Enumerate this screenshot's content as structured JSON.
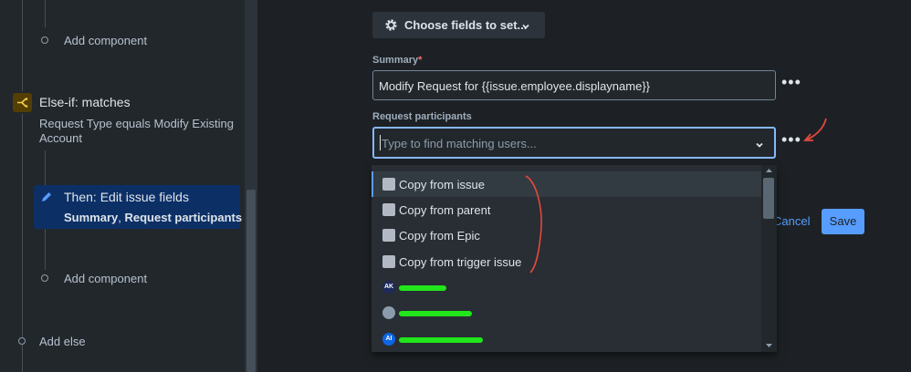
{
  "rule_panel": {
    "add_component_top": "Add component",
    "else_if_title": "Else-if: matches",
    "else_if_condition_line1": "Request Type equals Modify Existing",
    "else_if_condition_line2": "Account",
    "then_title": "Then: Edit issue fields",
    "then_fields_a": "Summary",
    "then_fields_sep": ", ",
    "then_fields_b": "Request participants",
    "add_component_bottom": "Add component",
    "add_else": "Add else"
  },
  "editor": {
    "choose_fields_label": "Choose fields to set...",
    "summary_label": "Summary",
    "summary_required": "*",
    "summary_value": "Modify Request for {{issue.employee.displayname}}",
    "participants_label": "Request participants",
    "participants_placeholder": "Type to find matching users...",
    "cancel_label": "Cancel",
    "save_label": "Save"
  },
  "dropdown": {
    "options": [
      {
        "label": "Copy from issue"
      },
      {
        "label": "Copy from parent"
      },
      {
        "label": "Copy from Epic"
      },
      {
        "label": "Copy from trigger issue"
      }
    ],
    "users": [
      {
        "initials": "AK",
        "color": "#1d2b5c"
      },
      {
        "initials": "",
        "color": "#8c9bab"
      },
      {
        "initials": "AI",
        "color": "#0c66e4"
      }
    ]
  },
  "annotation_colors": {
    "red": "#e2483d",
    "green": "#22e51c"
  }
}
